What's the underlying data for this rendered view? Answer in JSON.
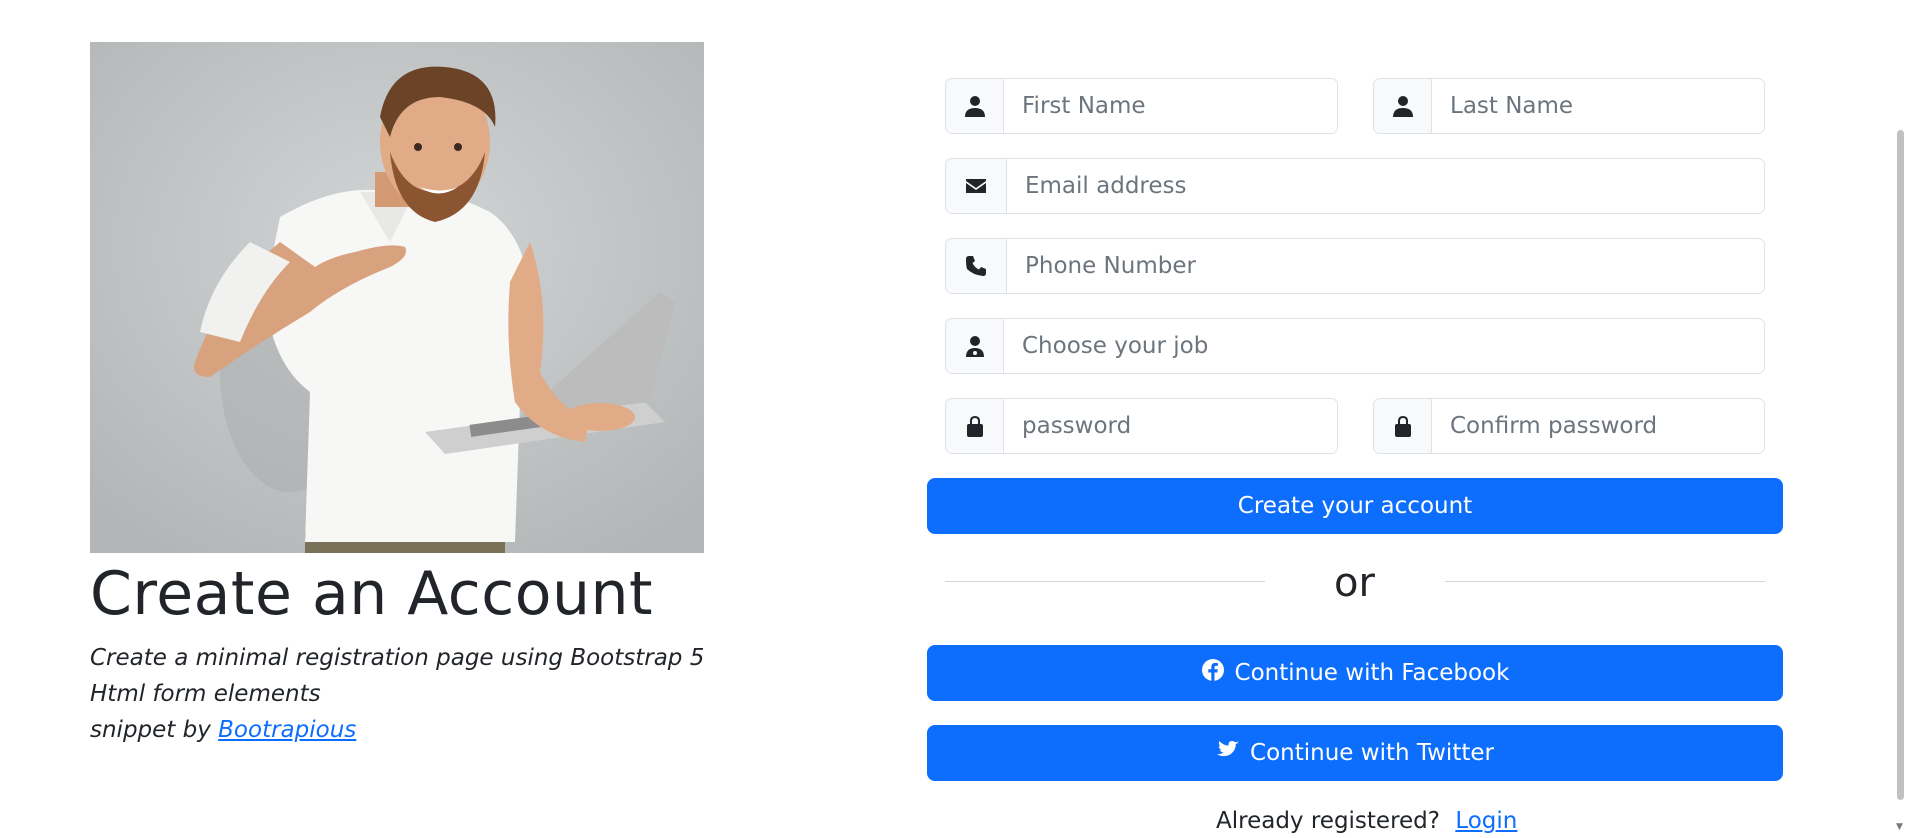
{
  "hero": {
    "title": "Create an Account"
  },
  "description": {
    "line1": "Create a minimal registration page using Bootstrap 5",
    "line2": "Html form elements",
    "snippet_prefix": "snippet by",
    "snippet_link": "Bootrapious"
  },
  "form": {
    "first_name": {
      "placeholder": "First Name",
      "icon": "user-icon"
    },
    "last_name": {
      "placeholder": "Last Name",
      "icon": "user-icon"
    },
    "email": {
      "placeholder": "Email address",
      "icon": "envelope-icon"
    },
    "phone": {
      "placeholder": "Phone Number",
      "icon": "phone-icon"
    },
    "job": {
      "placeholder": "Choose your job",
      "icon": "user-doctor-icon"
    },
    "password": {
      "placeholder": "password",
      "icon": "lock-icon"
    },
    "confirm_password": {
      "placeholder": "Confirm password",
      "icon": "lock-icon"
    },
    "submit_label": "Create your account",
    "or_label": "or",
    "facebook_label": "Continue with Facebook",
    "twitter_label": "Continue with Twitter",
    "already_text": "Already registered?",
    "login_label": "Login"
  },
  "colors": {
    "primary": "#0d6efd",
    "text": "#212529",
    "addon_bg": "#f8f9fa",
    "border": "#dee2e6"
  }
}
